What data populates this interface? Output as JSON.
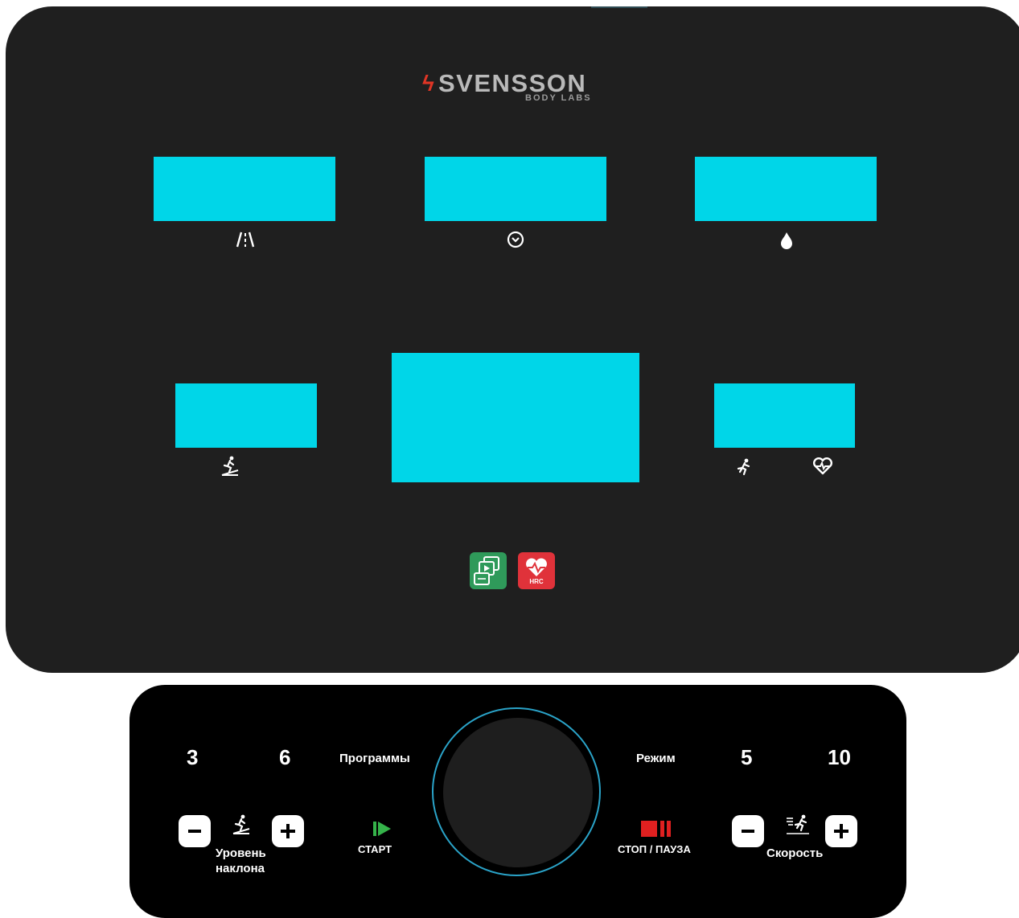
{
  "brand": {
    "name": "SVENSSON",
    "sub": "BODY LABS",
    "accent_color": "#e03525"
  },
  "colors": {
    "display": "#00d6e8",
    "console": "#1f1f1f",
    "control_panel": "#000000",
    "knob_ring": "#2aa3c8",
    "start": "#35b34a",
    "stop": "#e02020"
  },
  "displays": [
    {
      "icon": "distance-icon"
    },
    {
      "icon": "time-icon"
    },
    {
      "icon": "calories-icon"
    },
    {
      "icon": "incline-icon"
    },
    {
      "icon": "main-display"
    },
    {
      "icons": [
        "speed-icon",
        "heart-rate-icon"
      ]
    }
  ],
  "apps": {
    "programs_icon": "programs-app-icon",
    "hrc_label": "HRC"
  },
  "controls": {
    "incline_quick": [
      "3",
      "6"
    ],
    "programs_label": "Программы",
    "mode_label": "Режим",
    "speed_quick": [
      "5",
      "10"
    ],
    "incline_label_line1": "Уровень",
    "incline_label_line2": "наклона",
    "start_label": "СТАРТ",
    "stop_label": "СТОП / ПАУЗА",
    "speed_label": "Скорость"
  }
}
